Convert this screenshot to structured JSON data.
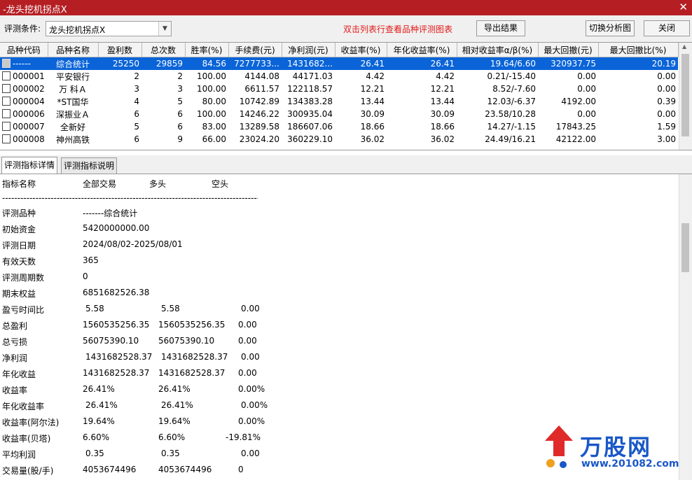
{
  "window": {
    "title": "-龙头挖机拐点X",
    "close_glyph": "✕"
  },
  "toolbar": {
    "condition_label": "评测条件:",
    "condition_value": "龙头挖机拐点X",
    "hint": "双击列表行查看品种评测图表",
    "export_label": "导出结果",
    "switch_label": "切换分析图",
    "close_label": "关闭"
  },
  "grid": {
    "columns": [
      "品种代码",
      "品种名称",
      "盈利数",
      "总次数",
      "胜率(%)",
      "手续费(元)",
      "净利润(元)",
      "收益率(%)",
      "年化收益率(%)",
      "相对收益率α/β(%)",
      "最大回撤(元)",
      "最大回撤比(%)"
    ],
    "rows": [
      {
        "code": "------",
        "name": "综合统计",
        "win": "25250",
        "total": "29859",
        "rate": "84.56",
        "fee": "7277733...",
        "profit": "1431682...",
        "ret": "26.41",
        "annual": "26.41",
        "rel": "19.64/6.60",
        "dd": "320937.75",
        "ddr": "20.19"
      },
      {
        "code": "000001",
        "name": "平安银行",
        "win": "2",
        "total": "2",
        "rate": "100.00",
        "fee": "4144.08",
        "profit": "44171.03",
        "ret": "4.42",
        "annual": "4.42",
        "rel": "0.21/-15.40",
        "dd": "0.00",
        "ddr": "0.00"
      },
      {
        "code": "000002",
        "name": "万 科Ａ",
        "win": "3",
        "total": "3",
        "rate": "100.00",
        "fee": "6611.57",
        "profit": "122118.57",
        "ret": "12.21",
        "annual": "12.21",
        "rel": "8.52/-7.60",
        "dd": "0.00",
        "ddr": "0.00"
      },
      {
        "code": "000004",
        "name": "*ST国华",
        "win": "4",
        "total": "5",
        "rate": "80.00",
        "fee": "10742.89",
        "profit": "134383.28",
        "ret": "13.44",
        "annual": "13.44",
        "rel": "12.03/-6.37",
        "dd": "4192.00",
        "ddr": "0.39"
      },
      {
        "code": "000006",
        "name": "深振业Ａ",
        "win": "6",
        "total": "6",
        "rate": "100.00",
        "fee": "14246.22",
        "profit": "300935.04",
        "ret": "30.09",
        "annual": "30.09",
        "rel": "23.58/10.28",
        "dd": "0.00",
        "ddr": "0.00"
      },
      {
        "code": "000007",
        "name": "全新好",
        "win": "5",
        "total": "6",
        "rate": "83.00",
        "fee": "13289.58",
        "profit": "186607.06",
        "ret": "18.66",
        "annual": "18.66",
        "rel": "14.27/-1.15",
        "dd": "17843.25",
        "ddr": "1.59"
      },
      {
        "code": "000008",
        "name": "神州高铁",
        "win": "6",
        "total": "9",
        "rate": "66.00",
        "fee": "23024.20",
        "profit": "360229.10",
        "ret": "36.02",
        "annual": "36.02",
        "rel": "24.49/16.21",
        "dd": "42122.00",
        "ddr": "3.00"
      }
    ]
  },
  "tabs": {
    "detail": "评测指标详情",
    "explain": "评测指标说明"
  },
  "detail": {
    "headers": {
      "name": "指标名称",
      "all": "全部交易",
      "long": "多头",
      "short": "空头"
    },
    "separator": "---------------------------------------------------------------------------------------------",
    "rows": [
      {
        "label": "评测品种",
        "a": "-------综合统计",
        "b": "",
        "c": ""
      },
      {
        "label": "初始资金",
        "a": "5420000000.00",
        "b": "",
        "c": ""
      },
      {
        "label": "评测日期",
        "a": "2024/08/02-2025/08/01",
        "b": "",
        "c": ""
      },
      {
        "label": "有效天数",
        "a": "365",
        "b": "",
        "c": ""
      },
      {
        "label": "评测周期数",
        "a": "0",
        "b": "",
        "c": ""
      },
      {
        "label": "期末权益",
        "a": "6851682526.38",
        "b": "",
        "c": ""
      },
      {
        "label": "盈亏时间比",
        "a": "5.58",
        "b": "5.58",
        "c": "0.00"
      },
      {
        "label": "总盈利",
        "a": "1560535256.35",
        "b": "1560535256.35",
        "c": "0.00"
      },
      {
        "label": "总亏损",
        "a": "56075390.10",
        "b": "56075390.10",
        "c": "0.00"
      },
      {
        "label": "净利润",
        "a": "1431682528.37",
        "b": "1431682528.37",
        "c": "0.00"
      },
      {
        "label": "年化收益",
        "a": "1431682528.37",
        "b": "1431682528.37",
        "c": "0.00"
      },
      {
        "label": "收益率",
        "a": "26.41%",
        "b": "26.41%",
        "c": "0.00%"
      },
      {
        "label": "年化收益率",
        "a": "26.41%",
        "b": "26.41%",
        "c": "0.00%"
      },
      {
        "label": "收益率(阿尔法)",
        "a": "19.64%",
        "b": "19.64%",
        "c": "0.00%"
      },
      {
        "label": "收益率(贝塔)",
        "a": "6.60%",
        "b": "6.60%",
        "c": "-19.81%"
      },
      {
        "label": "平均利润",
        "a": "0.35",
        "b": "0.35",
        "c": "0.00"
      },
      {
        "label": "交易量(股/手)",
        "a": "4053674496",
        "b": "4053674496",
        "c": "0"
      }
    ]
  },
  "watermark": {
    "brand": "万股网",
    "url": "www.201082.com"
  },
  "colors": {
    "titlebar": "#b51f24",
    "selection": "#0a64d8",
    "hint": "#e31a1a",
    "brand": "#1a57c8"
  }
}
